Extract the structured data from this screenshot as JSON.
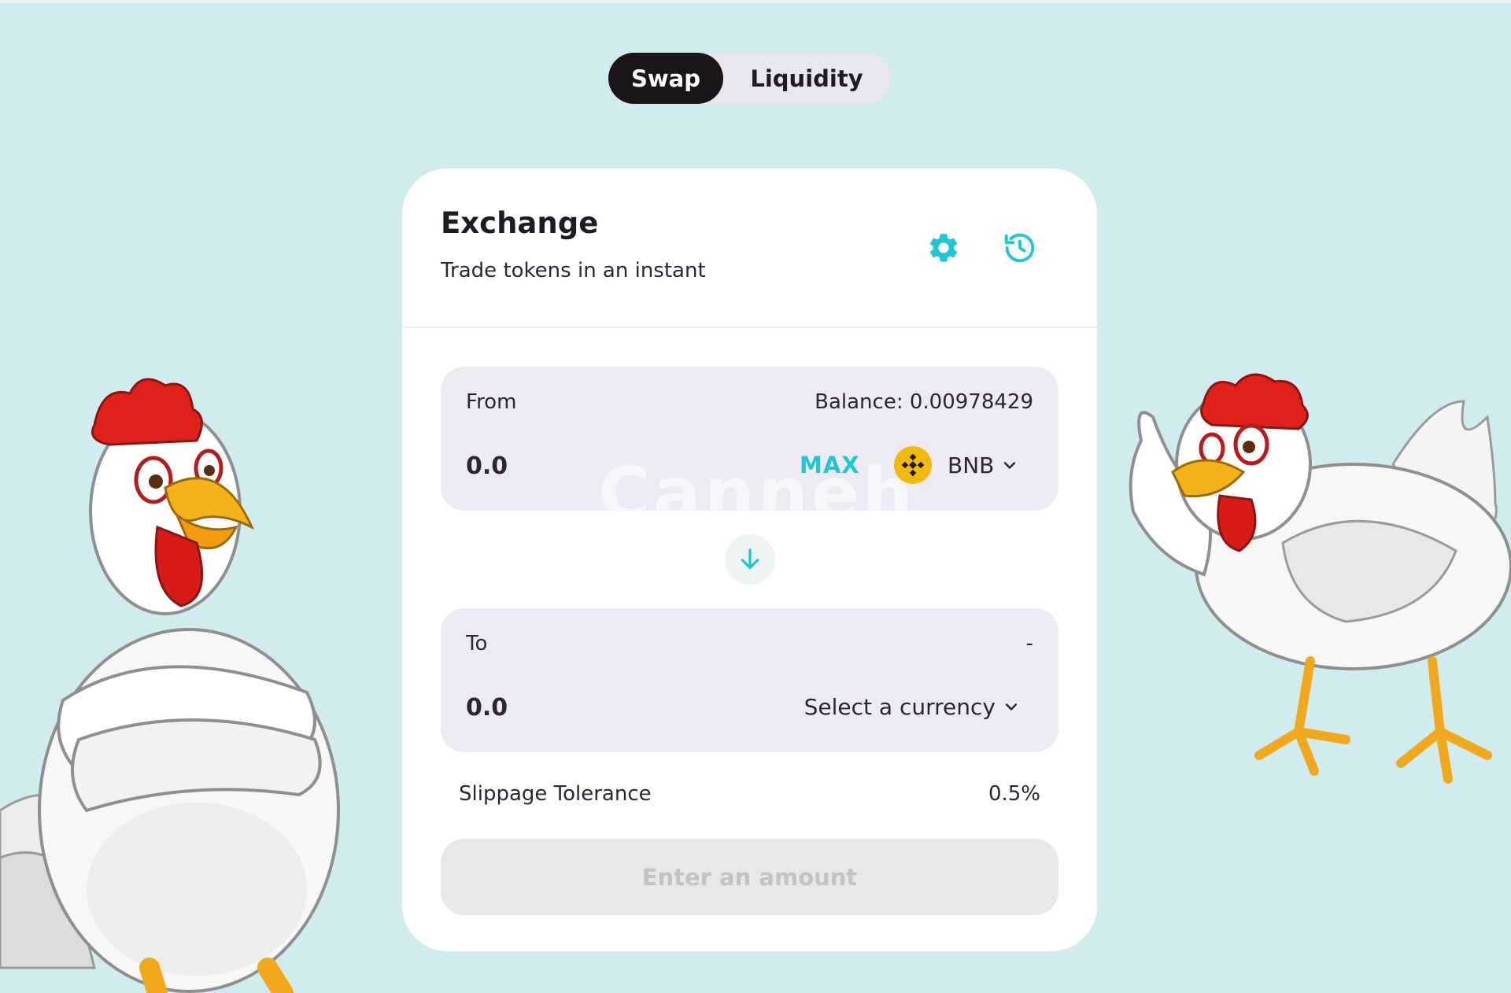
{
  "tabs": {
    "swap_label": "Swap",
    "liquidity_label": "Liquidity",
    "active": "Swap"
  },
  "card": {
    "title": "Exchange",
    "subtitle": "Trade tokens in an instant",
    "settings_icon": "gear-icon",
    "history_icon": "history-icon"
  },
  "from": {
    "label": "From",
    "balance": "Balance: 0.00978429",
    "amount_placeholder": "0.0",
    "max_label": "MAX",
    "token": "BNB",
    "token_icon": "bnb-logo-icon"
  },
  "switch": {
    "icon": "arrow-down-icon"
  },
  "to": {
    "label": "To",
    "balance": "-",
    "amount_placeholder": "0.0",
    "select_label": "Select a currency"
  },
  "slippage": {
    "label": "Slippage Tolerance",
    "value": "0.5%"
  },
  "submit": {
    "label": "Enter an amount"
  },
  "watermark": "Canneh",
  "colors": {
    "background": "#d1ecee",
    "accent": "#1fc7d4",
    "active_tab": "#1b1419",
    "panel": "#eeeaf4",
    "bnb": "#f0b90b"
  }
}
